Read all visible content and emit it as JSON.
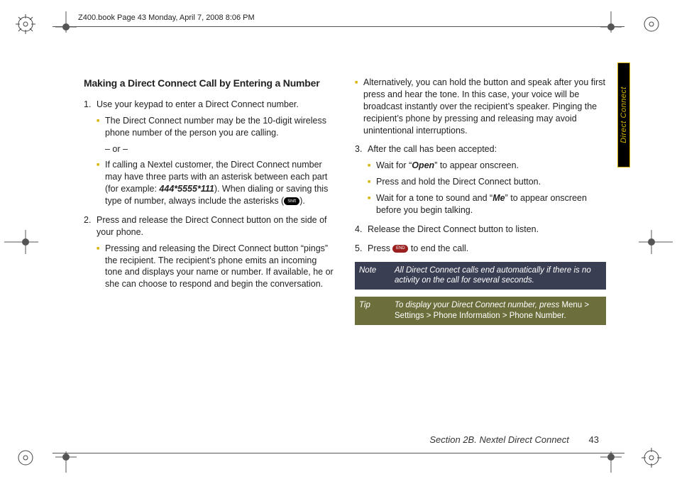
{
  "header": "Z400.book  Page 43  Monday, April 7, 2008  8:06 PM",
  "sideTab": "Direct Connect",
  "title": "Making a Direct Connect Call by Entering a Number",
  "leftCol": {
    "step1": {
      "num": "1.",
      "text": "Use your keypad to enter a Direct Connect number.",
      "sub1": "The Direct Connect number may be the 10-digit wireless phone number of the person you are calling.",
      "or": "– or –",
      "sub2a": "If calling a Nextel customer, the Direct Connect number may have three parts with an asterisk between each part (for example: ",
      "sub2ex": "444*5555*111",
      "sub2b": "). When dialing or saving this type of number, always include the asterisks (",
      "sub2c": ")."
    },
    "step2": {
      "num": "2.",
      "text": "Press and release the Direct Connect button on the side of your phone.",
      "sub1": "Pressing and releasing the Direct Connect button “pings” the recipient. The recipient’s phone emits an incoming tone and displays your name or number. If available, he or she can choose to respond and begin the conversation."
    }
  },
  "rightCol": {
    "contSub": "Alternatively, you can hold the button and speak after you first press and hear the tone. In this case, your voice will be broadcast instantly over the recipient’s speaker. Pinging the recipient’s phone by pressing and releasing may avoid unintentional interruptions.",
    "step3": {
      "num": "3.",
      "text": "After the call has been accepted:",
      "sub1a": "Wait for “",
      "sub1b": "Open",
      "sub1c": "” to appear onscreen.",
      "sub2": "Press and hold the Direct Connect button.",
      "sub3a": "Wait for a tone to sound and “",
      "sub3b": "Me",
      "sub3c": "” to appear onscreen before you begin talking."
    },
    "step4": {
      "num": "4.",
      "text": "Release the Direct Connect button to listen."
    },
    "step5": {
      "num": "5.",
      "textA": "Press ",
      "textB": " to end the call."
    },
    "note": {
      "label": "Note",
      "body": "All Direct Connect calls end automatically if there is no activity on the call for several seconds."
    },
    "tip": {
      "label": "Tip",
      "bodyA": "To display your Direct Connect number, press ",
      "bodyB": "Menu > Settings > Phone Information > Phone Number."
    }
  },
  "footer": {
    "section": "Section 2B. Nextel Direct Connect",
    "page": "43"
  },
  "icons": {
    "shift": "Shift",
    "end": "END"
  }
}
